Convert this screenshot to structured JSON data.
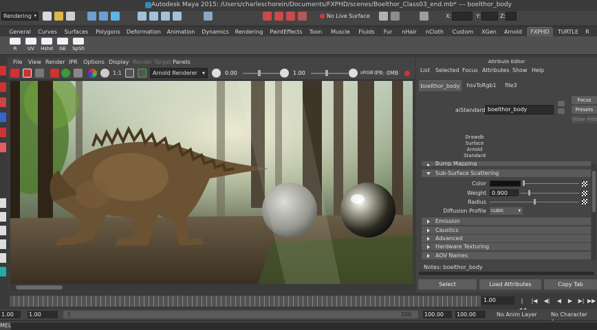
{
  "window": {
    "title": "Autodesk Maya 2015: /Users/charleschorein/Documents/FXPHD/scenes/Boelthor_Class03_end.mb*   ---   boelthor_body"
  },
  "status_line": {
    "menu_set": "Rendering",
    "live_surface": "No Live Surface",
    "x_label": "X:",
    "y_label": "Y:",
    "z_label": "Z:"
  },
  "shelf": {
    "tabs": [
      "General",
      "Curves",
      "Surfaces",
      "Polygons",
      "Deformation",
      "Animation",
      "Dynamics",
      "Rendering",
      "PaintEffects",
      "Toon",
      "Muscle",
      "Fluids",
      "Fur",
      "nHair",
      "nCloth",
      "Custom",
      "XGen",
      "Arnold",
      "FXPHD",
      "TURTLE",
      "R"
    ],
    "active_tab": "FXPHD",
    "buttons": [
      "R",
      "UV",
      "Hshd",
      "GE",
      "SpSh"
    ]
  },
  "viewport": {
    "menus": [
      "File",
      "View",
      "Render",
      "IPR",
      "Options",
      "Display",
      "Render Target",
      "Panels"
    ],
    "renderer": "Arnold Renderer",
    "exposure": "0.00",
    "gamma": "1.00",
    "ratio": "1:1",
    "ipr_status": "IPR: 0MB",
    "srgb": "sRGB"
  },
  "attribute_editor": {
    "title": "Attribute Editor",
    "menus": [
      "List",
      "Selected",
      "Focus",
      "Attributes",
      "Show",
      "Help"
    ],
    "tabs": [
      "boelthor_body",
      "hsvToRgb1",
      "file3"
    ],
    "node_type_label": "aiStandard:",
    "node_name": "boelthor_body",
    "buttons": {
      "focus": "Focus",
      "presets": "Presets",
      "show": "Show",
      "hide": "Hide"
    },
    "swatch_caption": [
      "Drawdb",
      "Surface",
      "Arnold",
      "Standard"
    ],
    "sections": {
      "bump": "Bump Mapping",
      "sss": "Sub-Surface Scattering",
      "emission": "Emission",
      "caustics": "Caustics",
      "advanced": "Advanced",
      "hardware": "Hardware Texturing",
      "aov": "AOV Names"
    },
    "sss_attrs": {
      "color_label": "Color",
      "weight_label": "Weight",
      "weight_value": "0.900",
      "radius_label": "Radius",
      "diffusion_label": "Diffusion Profile",
      "diffusion_value": "cubic"
    },
    "notes_label": "Notes:  boelthor_body",
    "bottom_buttons": [
      "Select",
      "Load Attributes",
      "Copy Tab"
    ]
  },
  "time_slider": {
    "current_frame": "1.00",
    "playback": [
      "|◀◀",
      "|◀",
      "◀|",
      "◀",
      "▶",
      "▶|",
      "▶▶|"
    ]
  },
  "range_slider": {
    "start_field": "1.00",
    "start_field2": "1.00",
    "bar_start": "1",
    "bar_end": "100",
    "end_field": "100.00",
    "end_field2": "100.00",
    "anim_layer": "No Anim Layer",
    "character_set": "No Character Set"
  },
  "command_line": {
    "language": "MEL"
  },
  "colors": {
    "accent_blue": "#2e8bc0",
    "ipr_red": "#d93030",
    "panel_bg": "#444444"
  }
}
